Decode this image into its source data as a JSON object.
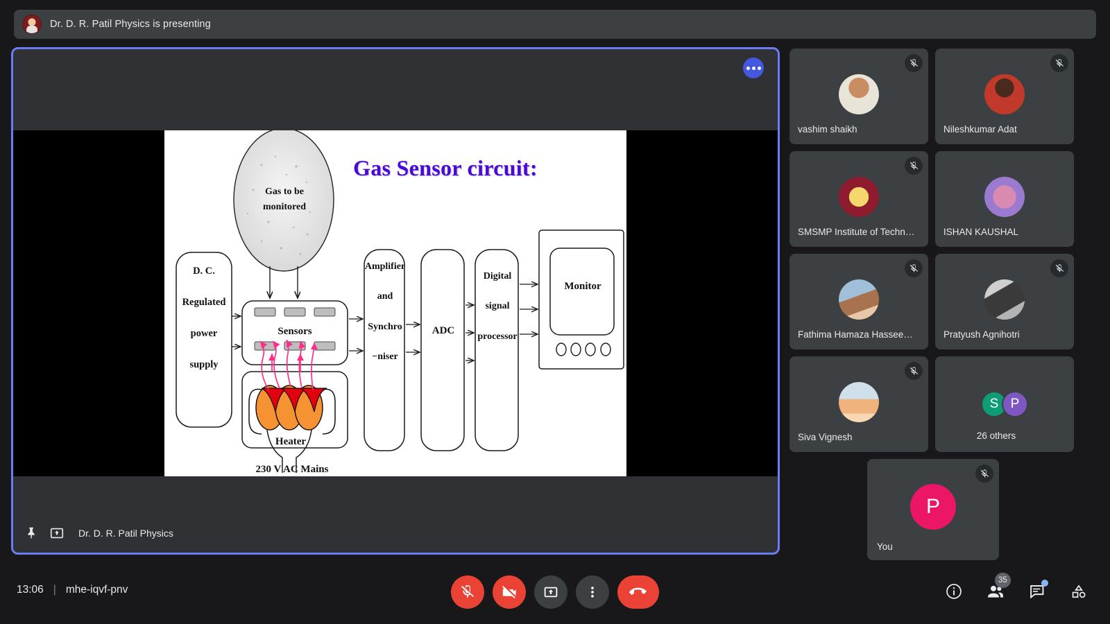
{
  "banner": {
    "text": "Dr. D. R. Patil Physics is presenting",
    "avatar_icon": "presenter-avatar"
  },
  "stage": {
    "more_options_icon": "more-options-icon",
    "pin_icon": "pin-icon",
    "present_icon": "present-screen-icon",
    "presenter_name": "Dr. D. R. Patil Physics"
  },
  "slide": {
    "title": "Gas Sensor circuit:",
    "title_color": "#4a0ad6",
    "blocks": [
      {
        "label": "Gas to be\nmonitored"
      },
      {
        "label": "D. C.\n\nRegulated\n\npower\n\nsupply"
      },
      {
        "label": "Sensors"
      },
      {
        "label": "Amplifier\n\nand\n\nSynchro\n\n−niser"
      },
      {
        "label": "ADC"
      },
      {
        "label": "Digital\n\nsignal\n\nprocessor"
      },
      {
        "label": "Monitor"
      },
      {
        "label": "Heater"
      },
      {
        "label": "230 V AC Mains"
      }
    ]
  },
  "participants": {
    "tiles": [
      {
        "name": "vashim shaikh",
        "muted": true,
        "avatar_icon": "avatar-photo"
      },
      {
        "name": "Nileshkumar Adat",
        "muted": true,
        "avatar_icon": "avatar-photo"
      },
      {
        "name": "SMSMP Institute of Techn…",
        "muted": true,
        "avatar_icon": "avatar-logo"
      },
      {
        "name": "ISHAN KAUSHAL",
        "muted": true,
        "avatar_icon": "avatar-photo"
      },
      {
        "name": "Fathima Hamaza Hassee…",
        "muted": true,
        "avatar_icon": "avatar-photo"
      },
      {
        "name": "Pratyush Agnihotri",
        "muted": true,
        "avatar_icon": "avatar-photo"
      },
      {
        "name": "Siva Vignesh",
        "muted": true,
        "avatar_icon": "avatar-photo"
      }
    ],
    "overflow": {
      "label": "26 others",
      "initials": [
        "S",
        "P"
      ],
      "colors": [
        "#0f9d76",
        "#7e57c2"
      ]
    },
    "self": {
      "name": "You",
      "initial": "P",
      "color": "#ec1667",
      "muted": true
    }
  },
  "bottom": {
    "time": "13:06",
    "separator": "|",
    "meeting_code": "mhe-iqvf-pnv",
    "controls": [
      {
        "name": "microphone-off-button",
        "icon": "mic-off-icon",
        "state": "muted",
        "color": "#ea4335"
      },
      {
        "name": "camera-off-button",
        "icon": "camera-off-icon",
        "state": "off",
        "color": "#ea4335"
      },
      {
        "name": "present-now-button",
        "icon": "present-icon",
        "color": "#3c4043"
      },
      {
        "name": "more-options-button",
        "icon": "kebab-menu-icon",
        "color": "#3c4043"
      },
      {
        "name": "leave-call-button",
        "icon": "end-call-icon",
        "color": "#ea4335"
      }
    ],
    "right_icons": [
      {
        "name": "meeting-details-button",
        "icon": "info-icon"
      },
      {
        "name": "participants-button",
        "icon": "people-icon",
        "badge": "35"
      },
      {
        "name": "chat-button",
        "icon": "chat-icon",
        "has_unread": true
      },
      {
        "name": "activities-button",
        "icon": "activities-icon"
      }
    ]
  }
}
